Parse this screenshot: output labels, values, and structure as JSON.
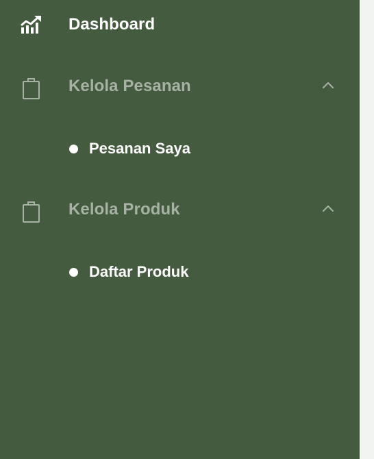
{
  "sidebar": {
    "dashboard": {
      "label": "Dashboard",
      "icon": "chart-line-up-icon"
    },
    "groups": [
      {
        "label": "Kelola Pesanan",
        "icon": "clipboard-icon",
        "expanded": true,
        "items": [
          {
            "label": "Pesanan Saya"
          }
        ]
      },
      {
        "label": "Kelola Produk",
        "icon": "clipboard-icon",
        "expanded": true,
        "items": [
          {
            "label": "Daftar Produk"
          }
        ]
      }
    ]
  },
  "colors": {
    "sidebar_background": "#455b3f",
    "active_text": "#ffffff",
    "muted_text": "#a7b1a4"
  }
}
